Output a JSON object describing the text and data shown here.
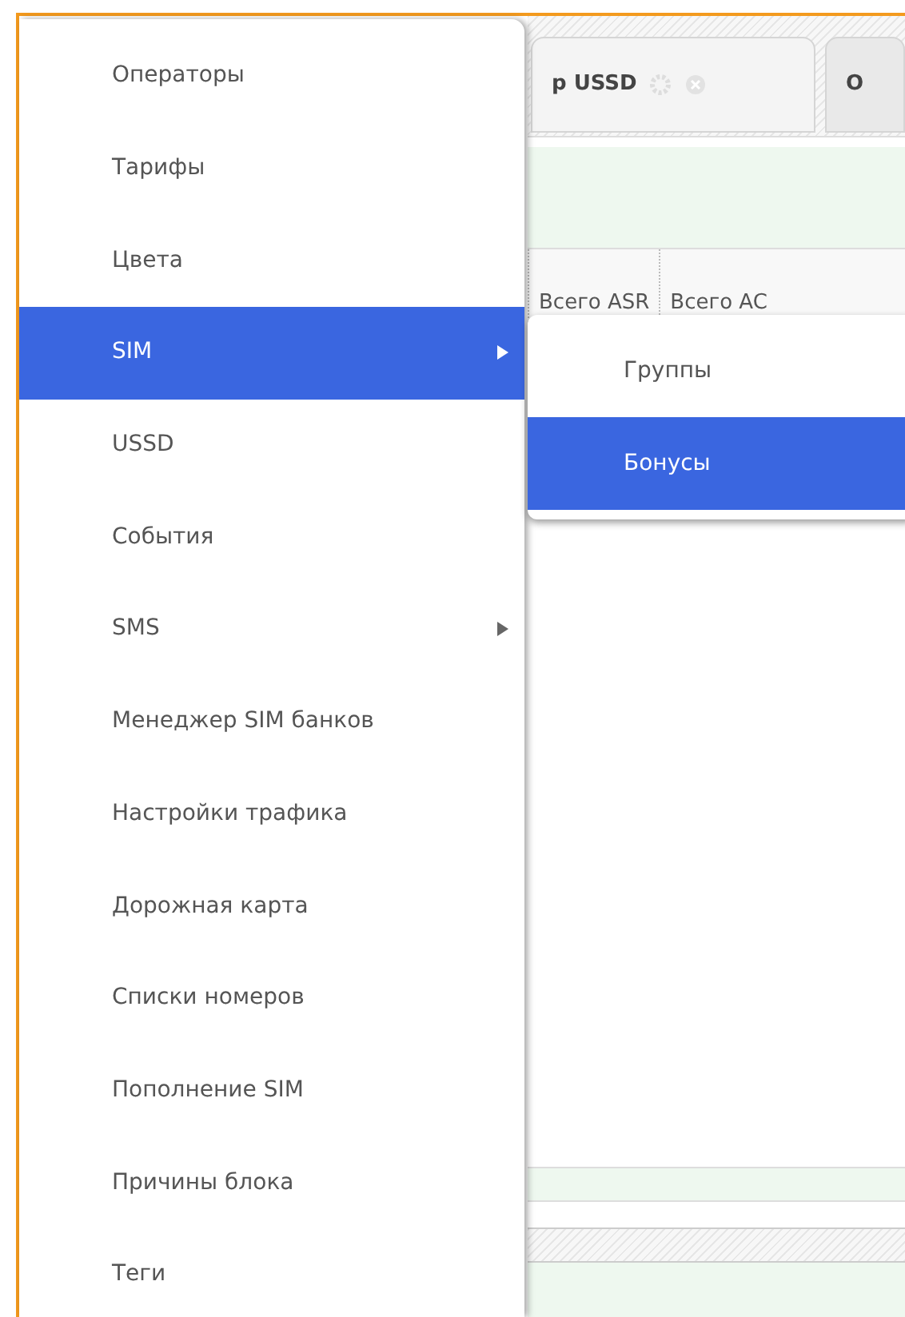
{
  "background": {
    "tabs": [
      {
        "label": "р USSD",
        "selected": true
      },
      {
        "label": "О",
        "selected": false
      }
    ],
    "table": {
      "columns": [
        "Всего ASR",
        "Всего AC"
      ]
    }
  },
  "menu": {
    "items": [
      {
        "label": "Операторы",
        "selected": false,
        "has_submenu": false
      },
      {
        "label": "Тарифы",
        "selected": false,
        "has_submenu": false
      },
      {
        "label": "Цвета",
        "selected": false,
        "has_submenu": false
      },
      {
        "label": "SIM",
        "selected": true,
        "has_submenu": true
      },
      {
        "label": "USSD",
        "selected": false,
        "has_submenu": false
      },
      {
        "label": "События",
        "selected": false,
        "has_submenu": false
      },
      {
        "label": "SMS",
        "selected": false,
        "has_submenu": true
      },
      {
        "label": "Менеджер SIM банков",
        "selected": false,
        "has_submenu": false
      },
      {
        "label": "Настройки трафика",
        "selected": false,
        "has_submenu": false
      },
      {
        "label": "Дорожная карта",
        "selected": false,
        "has_submenu": false
      },
      {
        "label": "Списки номеров",
        "selected": false,
        "has_submenu": false
      },
      {
        "label": "Пополнение SIM",
        "selected": false,
        "has_submenu": false
      },
      {
        "label": "Причины блока",
        "selected": false,
        "has_submenu": false
      },
      {
        "label": "Теги",
        "selected": false,
        "has_submenu": false
      }
    ]
  },
  "submenu": {
    "items": [
      {
        "label": "Группы",
        "selected": false
      },
      {
        "label": "Бонусы",
        "selected": true
      }
    ]
  }
}
